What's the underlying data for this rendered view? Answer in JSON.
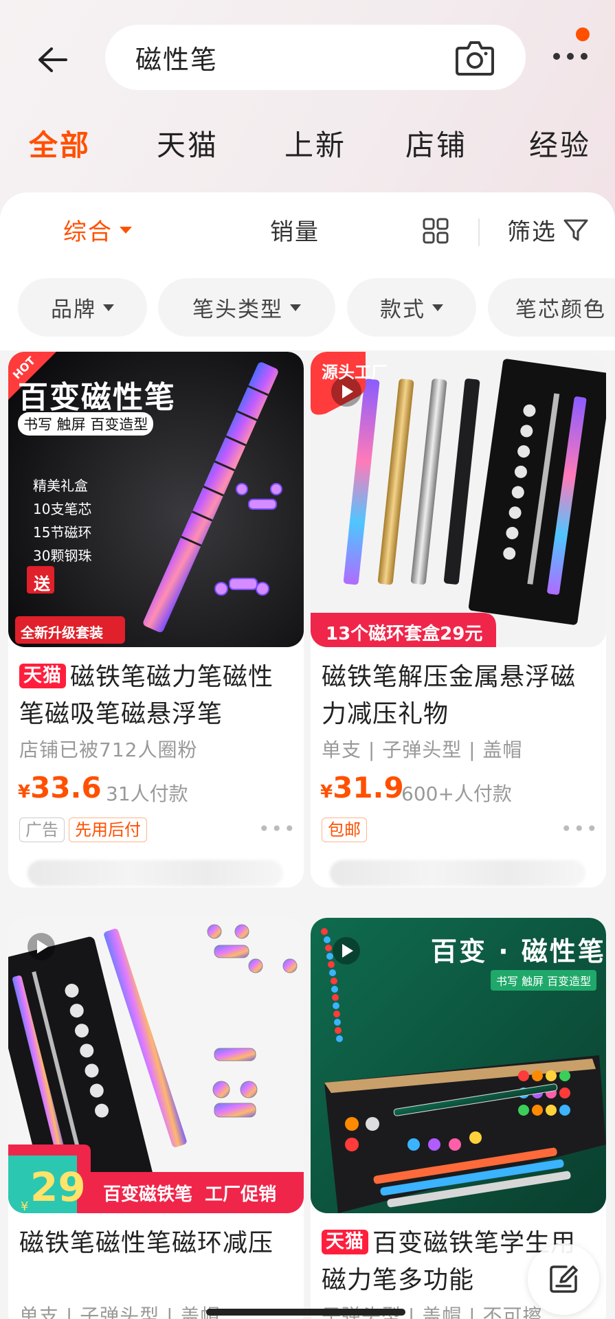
{
  "search": {
    "query": "磁性笔"
  },
  "tabs": [
    {
      "label": "全部",
      "active": true
    },
    {
      "label": "天猫"
    },
    {
      "label": "上新"
    },
    {
      "label": "店铺"
    },
    {
      "label": "经验"
    }
  ],
  "sortbar": {
    "comprehensive": "综合",
    "sales": "销量",
    "filter": "筛选"
  },
  "chips": [
    "品牌",
    "笔头类型",
    "款式",
    "笔芯颜色"
  ],
  "products": [
    {
      "image": {
        "hot": "HOT",
        "headline": "百变磁性笔",
        "subhead": "书写 触屏 百变造型",
        "features": [
          "精美礼盒",
          "10支笔芯",
          "15节磁环",
          "30颗钢珠"
        ],
        "gift": "送",
        "bottom_banner": "全新升级套装"
      },
      "brand_badge": "天猫",
      "title": "磁铁笔磁力笔磁性笔磁吸笔磁悬浮笔",
      "meta": "店铺已被712人圈粉",
      "currency": "¥",
      "price": "33.6",
      "sold": "31人付款",
      "tags": [
        "广告",
        "先用后付"
      ],
      "more": "•••"
    },
    {
      "image": {
        "source_badge": "源头工厂",
        "bottom_banner": "13个磁环套盒29元"
      },
      "title": "磁铁笔解压金属悬浮磁力减压礼物",
      "meta": "单支 | 子弹头型 | 盖帽",
      "currency": "¥",
      "price": "31.9",
      "sold": "600+人付款",
      "tags": [
        "包邮"
      ],
      "more": "•••"
    },
    {
      "image": {
        "price_badge": "29",
        "currency": "¥",
        "bottom_banner": "百变磁铁笔  工厂促销"
      },
      "title": "磁铁笔磁性笔磁环减压",
      "meta": "单支 | 子弹头型 | 盖帽"
    },
    {
      "image": {
        "headline": "百变 · 磁性笔",
        "subhead": "书写 触屏 百变造型"
      },
      "brand_badge": "天猫",
      "title": "百变磁铁笔学生用磁力笔多功能",
      "meta": "子弹头型 | 盖帽 | 不可擦"
    }
  ]
}
